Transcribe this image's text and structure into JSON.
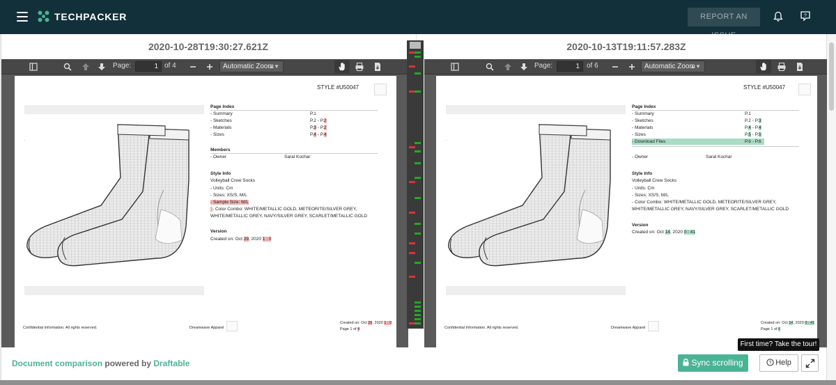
{
  "app": {
    "name": "TECHPACKER",
    "report_issue": "REPORT AN ISSUE"
  },
  "left": {
    "title": "2020-10-28T19:30:27.621Z",
    "toolbar": {
      "page_label": "Page:",
      "page_value": "1",
      "page_total": "of 4",
      "zoom": "Automatic Zoom"
    },
    "doc": {
      "style": "STYLE #U50047",
      "page_index_heading": "Page Index",
      "index": [
        {
          "label": "- Summary",
          "pages": "P.1"
        },
        {
          "label": "- Sketches",
          "pages_a": "P.2 - P.",
          "pages_b": "2"
        },
        {
          "label": "- Materials",
          "pages_a": "P.",
          "pages_b": "3",
          "pages_c": " - P.",
          "pages_d": "2"
        },
        {
          "label": "- Sizes",
          "pages_a": "P.",
          "pages_b": "4",
          "pages_c": " - P.",
          "pages_d": "4"
        }
      ],
      "members_heading": "Members",
      "owner_label": "- Owner",
      "owner_name": "Saral Kochar",
      "style_info_heading": "Style Info",
      "style_name": "Volleyball Crew Socks",
      "units": "- Units: Cm",
      "sizes": "- Sizes: XS/S, M/L",
      "sample_size": "- Sample Size: M/L",
      "color_combo_1": "- Color Combo: WHITE/METALLIC GOLD, METEORITE/SILVER GREY,",
      "color_combo_2": "WHITE/METALLIC GREY, NAVY/SILVER GREY, SCARLET/METALLIC GOLD",
      "version_heading": "Version",
      "created_a": "Created on: Oct ",
      "created_b": "29",
      "created_c": ", 2020 ",
      "created_d": "1 : 0",
      "footer_confidential": "Confidential Information. All rights reserved.",
      "footer_company": "Dreamwave Apparel",
      "footer_created_a": "Created on: Oct ",
      "footer_created_b": "29",
      "footer_created_c": ", 2020 ",
      "footer_created_d": "1 : 0",
      "footer_page_a": "Page 1 of ",
      "footer_page_b": "4"
    }
  },
  "right": {
    "title": "2020-10-13T19:11:57.283Z",
    "toolbar": {
      "page_label": "Page:",
      "page_value": "1",
      "page_total": "of 6",
      "zoom": "Automatic Zoom"
    },
    "doc": {
      "style": "STYLE #U50047",
      "page_index_heading": "Page Index",
      "index": [
        {
          "label": "- Summary",
          "pages": "P.1"
        },
        {
          "label": "- Sketches",
          "pages_a": "P.2 - P.",
          "pages_b": "3"
        },
        {
          "label": "- Materials",
          "pages_a": "P.",
          "pages_b": "4",
          "pages_c": " - P.",
          "pages_d": "4"
        },
        {
          "label": "- Sizes",
          "pages_a": "P.",
          "pages_b": "5",
          "pages_c": " - P.",
          "pages_d": "5"
        },
        {
          "label": "- Download Files",
          "pages_a": "P.6 - P.6"
        }
      ],
      "members_heading": "Members",
      "owner_label": "- Owner",
      "owner_name": "Saral Kochar",
      "style_info_heading": "Style Info",
      "style_name": "Volleyball Crew Socks",
      "units": "- Units: Cm",
      "sizes": "- Sizes: XS/S, M/L",
      "color_combo_1": "- Color Combo: WHITE/METALLIC GOLD, METEORITE/SILVER GREY,",
      "color_combo_2": "WHITE/METALLIC GREY, NAVY/SILVER GREY, SCARLET/METALLIC GOLD",
      "version_heading": "Version",
      "created_a": "Created on: Oct ",
      "created_b": "14",
      "created_c": ", 2020 ",
      "created_d": "0 : 41",
      "footer_confidential": "Confidential Information. All rights reserved.",
      "footer_company": "Dreamwave Apparel",
      "footer_created_a": "Created on: Oct ",
      "footer_created_b": "14",
      "footer_created_c": ", 2020 ",
      "footer_created_d": "0 : 41",
      "footer_page_a": "Page 1 of ",
      "footer_page_b": "6"
    }
  },
  "footer": {
    "doc_comparison": "Document comparison",
    "powered_by": " powered by ",
    "draftable": "Draftable",
    "sync_scrolling": "Sync scrolling",
    "help": "Help",
    "tour_tooltip": "First time? Take the tour!"
  },
  "colors": {
    "topbar": "#12303a",
    "accent_green": "#4bb395",
    "deleted": "#f4b3b3",
    "inserted": "#a8dcc4"
  },
  "icons": [
    "menu-icon",
    "techpacker-logo-icon",
    "bell-icon",
    "question-icon",
    "sidebar-toggle-icon",
    "search-icon",
    "arrow-up-icon",
    "arrow-down-icon",
    "minus-icon",
    "plus-icon",
    "hand-icon",
    "print-icon",
    "download-icon",
    "lock-icon",
    "expand-icon"
  ]
}
